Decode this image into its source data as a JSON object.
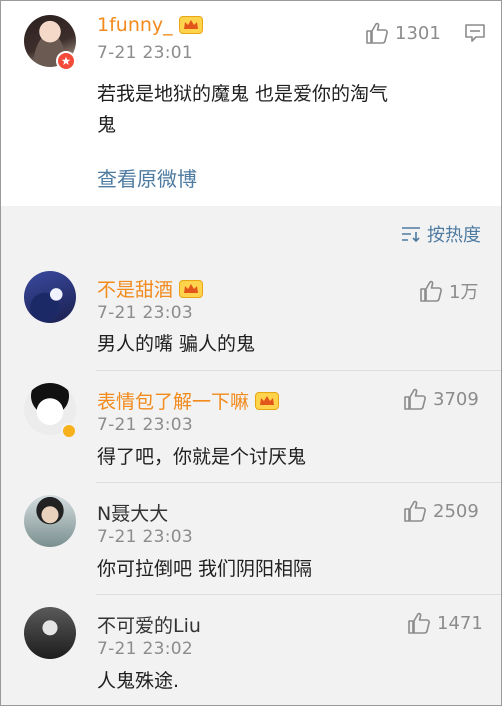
{
  "main_comment": {
    "username": "1funny_",
    "time": "7-21 23:01",
    "likes": "1301",
    "text_line1": "若我是地狱的魔鬼  也是爱你的淘气",
    "text_line2": "鬼",
    "view_original": "查看原微博"
  },
  "sort": {
    "label": "按热度"
  },
  "replies": [
    {
      "username": "不是甜酒",
      "time": "7-21 23:03",
      "likes": "1万",
      "text": "男人的嘴 骗人的鬼",
      "vip": true
    },
    {
      "username": "表情包了解一下嘛",
      "time": "7-21 23:03",
      "likes": "3709",
      "text": "得了吧，你就是个讨厌鬼",
      "vip": true
    },
    {
      "username": "N聂大大",
      "time": "7-21 23:03",
      "likes": "2509",
      "text": "你可拉倒吧   我们阴阳相隔",
      "vip": false
    },
    {
      "username": "不可爱的Liu",
      "time": "7-21 23:02",
      "likes": "1471",
      "text": "人鬼殊途.",
      "vip": false
    }
  ],
  "colors": {
    "accent_username": "#f28a1c",
    "link": "#4e7ba1",
    "muted": "#8c8c8c",
    "background": "#f2f2f2"
  },
  "icons": [
    "thumbs-up-icon",
    "comment-menu-icon",
    "sort-icon",
    "crown-icon",
    "avatar-badge-icon"
  ]
}
